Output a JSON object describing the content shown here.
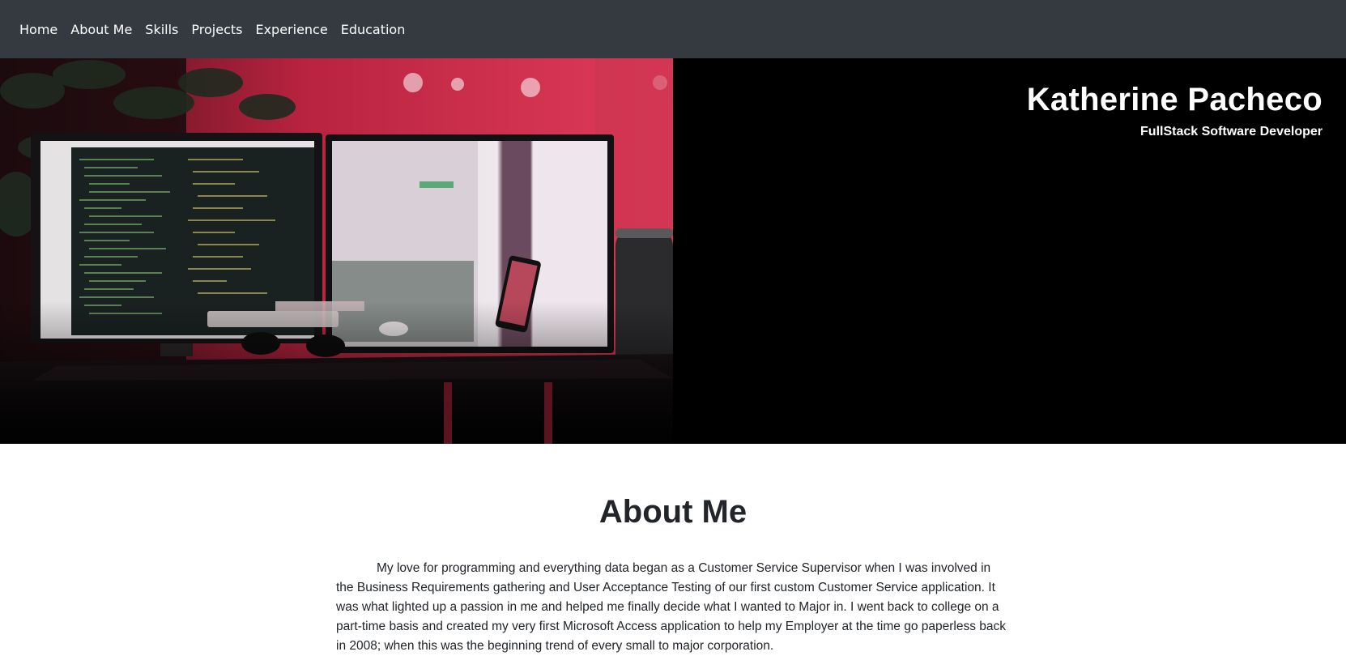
{
  "nav": {
    "items": [
      {
        "label": "Home"
      },
      {
        "label": "About Me"
      },
      {
        "label": "Skills"
      },
      {
        "label": "Projects"
      },
      {
        "label": "Experience"
      },
      {
        "label": "Education"
      }
    ]
  },
  "hero": {
    "name": "Katherine Pacheco",
    "role": "FullStack Software Developer",
    "image": "desk-workstation-photo"
  },
  "about": {
    "title": "About Me",
    "paragraph": "My love for programming and everything data began as a Customer Service Supervisor when I was involved in the Business Requirements gathering and User Acceptance Testing of our first custom Customer Service application. It was what lighted up a passion in me and helped me finally decide what I wanted to Major in. I went back to college on a part-time basis and created my very first Microsoft Access application to help my Employer at the time go paperless back in 2008; when this was the beginning trend of every small to major corporation."
  },
  "colors": {
    "navbar_bg": "#343a40",
    "hero_bg": "#000000",
    "text_dark": "#212529",
    "accent_red": "#d8324f"
  }
}
